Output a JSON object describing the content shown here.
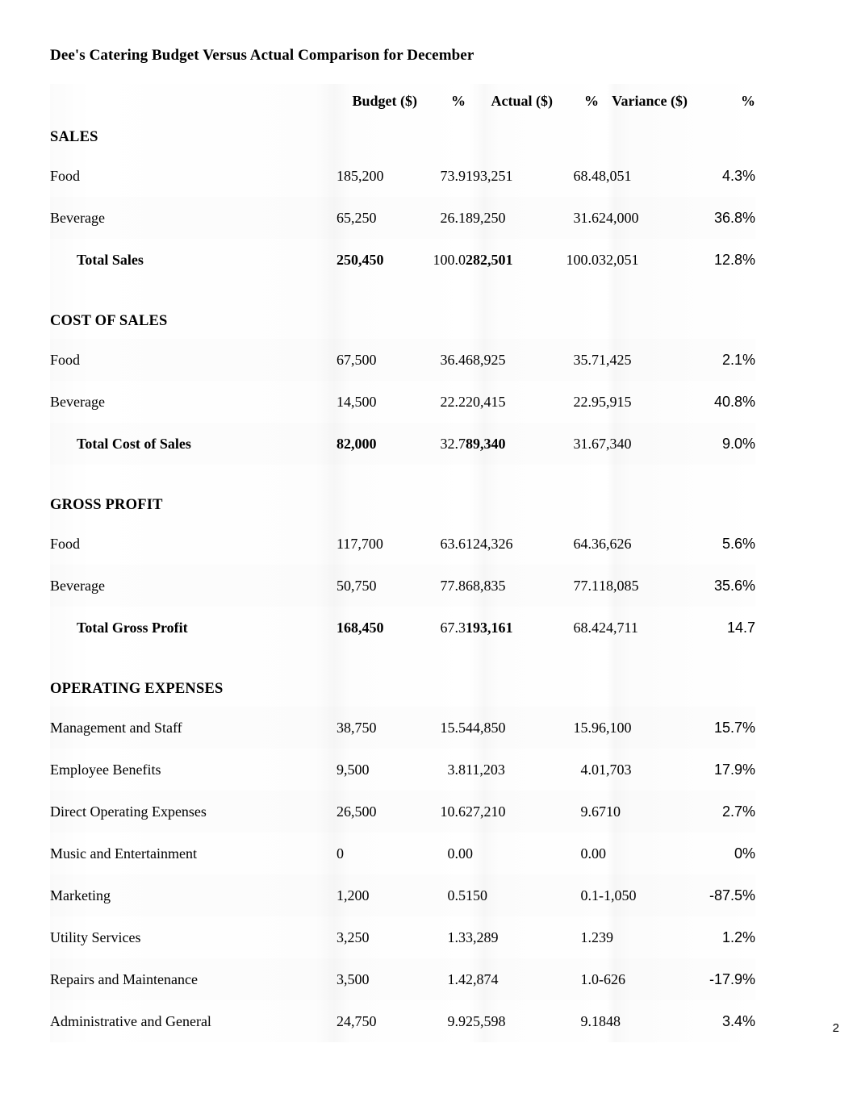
{
  "document": {
    "title": "Dee's Catering Budget Versus Actual Comparison for December",
    "page_number": "2"
  },
  "table": {
    "columns": [
      {
        "key": "label",
        "header": ""
      },
      {
        "key": "budget",
        "header": "Budget ($)"
      },
      {
        "key": "bpct",
        "header": "%"
      },
      {
        "key": "actual",
        "header": "Actual ($)"
      },
      {
        "key": "apct",
        "header": "%"
      },
      {
        "key": "var",
        "header": "Variance ($)"
      },
      {
        "key": "vpct",
        "header": "%"
      }
    ],
    "rows": [
      {
        "type": "section",
        "label": "SALES"
      },
      {
        "type": "data",
        "label": "Food",
        "budget": "185,200",
        "bpct": "73.9",
        "actual": "193,251",
        "apct": "68.4",
        "var": "8,051",
        "vpct": "4.3%"
      },
      {
        "type": "data",
        "label": "Beverage",
        "budget": "65,250",
        "bpct": "26.1",
        "actual": "89,250",
        "apct": "31.6",
        "var": "24,000",
        "vpct": "36.8%"
      },
      {
        "type": "total",
        "label": "Total Sales",
        "budget": "250,450",
        "bpct": "100.0",
        "actual": "282,501",
        "apct": "100.0",
        "var": "32,051",
        "vpct": "12.8%"
      },
      {
        "type": "spacer"
      },
      {
        "type": "section",
        "label": "COST OF SALES"
      },
      {
        "type": "data",
        "label": "Food",
        "budget": "67,500",
        "bpct": "36.4",
        "actual": "68,925",
        "apct": "35.7",
        "var": "1,425",
        "vpct": "2.1%"
      },
      {
        "type": "data",
        "label": "Beverage",
        "budget": "14,500",
        "bpct": "22.2",
        "actual": "20,415",
        "apct": "22.9",
        "var": "5,915",
        "vpct": "40.8%"
      },
      {
        "type": "total",
        "label": "Total Cost of Sales",
        "budget": "82,000",
        "bpct": "32.7",
        "actual": "89,340",
        "apct": "31.6",
        "var": "7,340",
        "vpct": "9.0%"
      },
      {
        "type": "spacer"
      },
      {
        "type": "section",
        "label": "GROSS PROFIT"
      },
      {
        "type": "data",
        "label": "Food",
        "budget": "117,700",
        "bpct": "63.6",
        "actual": "124,326",
        "apct": "64.3",
        "var": "6,626",
        "vpct": "5.6%"
      },
      {
        "type": "data",
        "label": "Beverage",
        "budget": "50,750",
        "bpct": "77.8",
        "actual": "68,835",
        "apct": "77.1",
        "var": "18,085",
        "vpct": "35.6%"
      },
      {
        "type": "total",
        "label": "Total Gross Profit",
        "budget": "168,450",
        "bpct": "67.3",
        "actual": "193,161",
        "apct": "68.4",
        "var": "24,711",
        "vpct": "14.7"
      },
      {
        "type": "spacer"
      },
      {
        "type": "section",
        "label": "OPERATING EXPENSES"
      },
      {
        "type": "data",
        "label": "Management and Staff",
        "budget": "38,750",
        "bpct": "15.5",
        "actual": "44,850",
        "apct": "15.9",
        "var": "6,100",
        "vpct": "15.7%"
      },
      {
        "type": "data",
        "label": "Employee Benefits",
        "budget": "9,500",
        "bpct": "3.8",
        "actual": "11,203",
        "apct": "4.0",
        "var": "1,703",
        "vpct": "17.9%"
      },
      {
        "type": "data",
        "label": "Direct Operating Expenses",
        "budget": "26,500",
        "bpct": "10.6",
        "actual": "27,210",
        "apct": "9.6",
        "var": "710",
        "vpct": "2.7%"
      },
      {
        "type": "data",
        "label": "Music and Entertainment",
        "budget": "0",
        "bpct": "0.0",
        "actual": "0",
        "apct": "0.0",
        "var": "0",
        "vpct": "0%"
      },
      {
        "type": "data",
        "label": "Marketing",
        "budget": "1,200",
        "bpct": "0.5",
        "actual": "150",
        "apct": "0.1",
        "var": "-1,050",
        "vpct": "-87.5%"
      },
      {
        "type": "data",
        "label": "Utility Services",
        "budget": "3,250",
        "bpct": "1.3",
        "actual": "3,289",
        "apct": "1.2",
        "var": "39",
        "vpct": "1.2%"
      },
      {
        "type": "data",
        "label": "Repairs and Maintenance",
        "budget": "3,500",
        "bpct": "1.4",
        "actual": "2,874",
        "apct": "1.0",
        "var": "-626",
        "vpct": "-17.9%"
      },
      {
        "type": "data",
        "label": "Administrative and General",
        "budget": "24,750",
        "bpct": "9.9",
        "actual": "25,598",
        "apct": "9.1",
        "var": "848",
        "vpct": "3.4%"
      }
    ]
  }
}
